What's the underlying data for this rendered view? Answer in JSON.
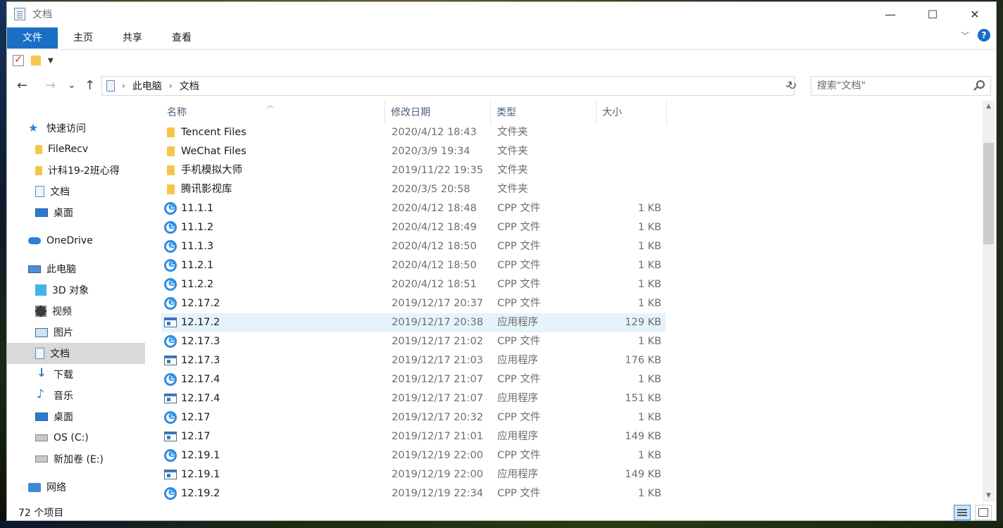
{
  "window": {
    "title": "文档"
  },
  "controls": {
    "minimize": "—",
    "maximize": "☐",
    "close": "✕"
  },
  "ribbon": {
    "tabs": [
      "文件",
      "主页",
      "共享",
      "查看"
    ],
    "help": "?"
  },
  "nav": {
    "back": "←",
    "forward": "→",
    "recent": "⌄",
    "up": "↑",
    "breadcrumb": [
      "此电脑",
      "文档"
    ],
    "refresh": "↻"
  },
  "search": {
    "placeholder": "搜索\"文档\""
  },
  "sidebar": {
    "items": [
      {
        "label": "快速访问",
        "icon": "star-icon"
      },
      {
        "label": "FileRecv",
        "icon": "folder-icon"
      },
      {
        "label": "计科19-2班心得",
        "icon": "folder-icon"
      },
      {
        "label": "文档",
        "icon": "document-icon"
      },
      {
        "label": "桌面",
        "icon": "desktop-icon"
      },
      {
        "label": "OneDrive",
        "icon": "cloud-icon"
      },
      {
        "label": "此电脑",
        "icon": "computer-icon"
      },
      {
        "label": "3D 对象",
        "icon": "cube-icon"
      },
      {
        "label": "视频",
        "icon": "video-icon"
      },
      {
        "label": "图片",
        "icon": "picture-icon"
      },
      {
        "label": "文档",
        "icon": "document-icon"
      },
      {
        "label": "下载",
        "icon": "download-icon"
      },
      {
        "label": "音乐",
        "icon": "music-icon"
      },
      {
        "label": "桌面",
        "icon": "desktop-icon"
      },
      {
        "label": "OS (C:)",
        "icon": "drive-icon"
      },
      {
        "label": "新加卷 (E:)",
        "icon": "drive-icon"
      },
      {
        "label": "网络",
        "icon": "network-icon"
      }
    ]
  },
  "columns": {
    "name": "名称",
    "date": "修改日期",
    "type": "类型",
    "size": "大小"
  },
  "files": [
    {
      "name": "Tencent Files",
      "date": "2020/4/12 18:43",
      "type": "文件夹",
      "size": "",
      "icon": "folder"
    },
    {
      "name": "WeChat Files",
      "date": "2020/3/9 19:34",
      "type": "文件夹",
      "size": "",
      "icon": "folder"
    },
    {
      "name": "手机模拟大师",
      "date": "2019/11/22 19:35",
      "type": "文件夹",
      "size": "",
      "icon": "folder"
    },
    {
      "name": "腾讯影视库",
      "date": "2020/3/5 20:58",
      "type": "文件夹",
      "size": "",
      "icon": "folder"
    },
    {
      "name": "11.1.1",
      "date": "2020/4/12 18:48",
      "type": "CPP 文件",
      "size": "1 KB",
      "icon": "ie"
    },
    {
      "name": "11.1.2",
      "date": "2020/4/12 18:49",
      "type": "CPP 文件",
      "size": "1 KB",
      "icon": "ie"
    },
    {
      "name": "11.1.3",
      "date": "2020/4/12 18:50",
      "type": "CPP 文件",
      "size": "1 KB",
      "icon": "ie"
    },
    {
      "name": "11.2.1",
      "date": "2020/4/12 18:50",
      "type": "CPP 文件",
      "size": "1 KB",
      "icon": "ie"
    },
    {
      "name": "11.2.2",
      "date": "2020/4/12 18:51",
      "type": "CPP 文件",
      "size": "1 KB",
      "icon": "ie"
    },
    {
      "name": "12.17.2",
      "date": "2019/12/17 20:37",
      "type": "CPP 文件",
      "size": "1 KB",
      "icon": "ie"
    },
    {
      "name": "12.17.2",
      "date": "2019/12/17 20:38",
      "type": "应用程序",
      "size": "129 KB",
      "icon": "exe",
      "hover": true
    },
    {
      "name": "12.17.3",
      "date": "2019/12/17 21:02",
      "type": "CPP 文件",
      "size": "1 KB",
      "icon": "ie"
    },
    {
      "name": "12.17.3",
      "date": "2019/12/17 21:03",
      "type": "应用程序",
      "size": "176 KB",
      "icon": "exe"
    },
    {
      "name": "12.17.4",
      "date": "2019/12/17 21:07",
      "type": "CPP 文件",
      "size": "1 KB",
      "icon": "ie"
    },
    {
      "name": "12.17.4",
      "date": "2019/12/17 21:07",
      "type": "应用程序",
      "size": "151 KB",
      "icon": "exe"
    },
    {
      "name": "12.17",
      "date": "2019/12/17 20:32",
      "type": "CPP 文件",
      "size": "1 KB",
      "icon": "ie"
    },
    {
      "name": "12.17",
      "date": "2019/12/17 21:01",
      "type": "应用程序",
      "size": "149 KB",
      "icon": "exe"
    },
    {
      "name": "12.19.1",
      "date": "2019/12/19 22:00",
      "type": "CPP 文件",
      "size": "1 KB",
      "icon": "ie"
    },
    {
      "name": "12.19.1",
      "date": "2019/12/19 22:00",
      "type": "应用程序",
      "size": "149 KB",
      "icon": "exe"
    },
    {
      "name": "12.19.2",
      "date": "2019/12/19 22:34",
      "type": "CPP 文件",
      "size": "1 KB",
      "icon": "ie"
    }
  ],
  "status": {
    "count": "72 个项目"
  }
}
